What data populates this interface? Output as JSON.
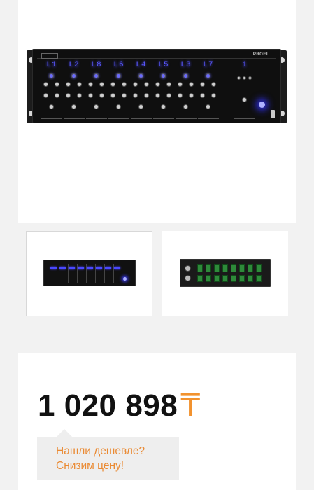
{
  "product": {
    "brand": "PROEL",
    "channel_displays": [
      "L1",
      "L2",
      "L8",
      "L6",
      "L4",
      "L5",
      "L3",
      "L7"
    ],
    "monitor_display": "1",
    "main_image_icon": "rack-mixer-front-image"
  },
  "gallery": {
    "thumbnails": [
      {
        "name": "front-view",
        "selected": true
      },
      {
        "name": "rear-view",
        "selected": false
      }
    ]
  },
  "price": {
    "amount": "1 020 898",
    "currency_symbol": "₸",
    "currency_color": "#f2922e"
  },
  "cheaper_offer": {
    "line1": "Нашли дешевле?",
    "line2": "Снизим цену!",
    "color": "#ea8a33"
  }
}
